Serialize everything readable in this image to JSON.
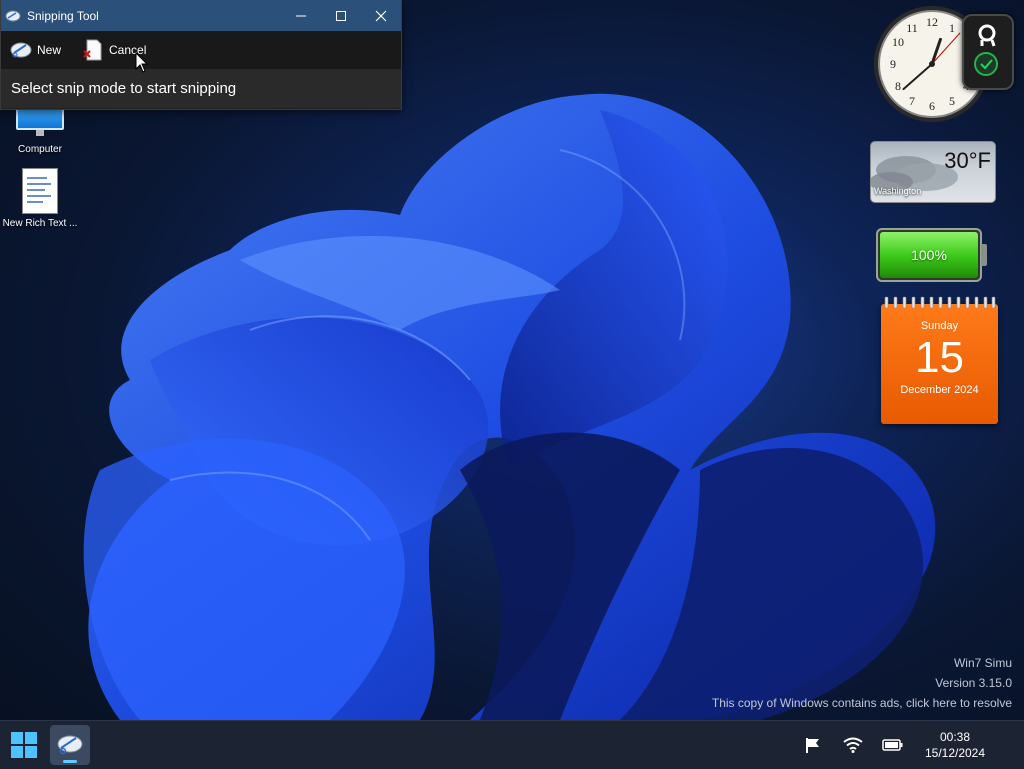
{
  "desktop": {
    "icons": [
      {
        "label": "Computer"
      },
      {
        "label": "New Rich Text ..."
      }
    ]
  },
  "snipping_tool": {
    "title": "Snipping Tool",
    "toolbar": {
      "new_label": "New",
      "cancel_label": "Cancel"
    },
    "message": "Select snip mode to start snipping"
  },
  "gadgets": {
    "weather": {
      "temperature": "30°F",
      "city": "Washington"
    },
    "battery": {
      "percent_label": "100%",
      "level": 1.0
    },
    "calendar": {
      "weekday": "Sunday",
      "day": "15",
      "month_year": "December 2024"
    },
    "clock": {
      "hour": 12,
      "minute": 38,
      "second": 7
    }
  },
  "watermark": {
    "product": "Win7 Simu",
    "version": "Version 3.15.0",
    "notice": "This copy of Windows contains ads, click here to resolve"
  },
  "taskbar": {
    "time": "00:38",
    "date": "15/12/2024"
  },
  "colors": {
    "accent": "#2b5079",
    "taskbar": "#1c2433",
    "calendar": "#e85a00",
    "battery": "#3ecb1c"
  }
}
